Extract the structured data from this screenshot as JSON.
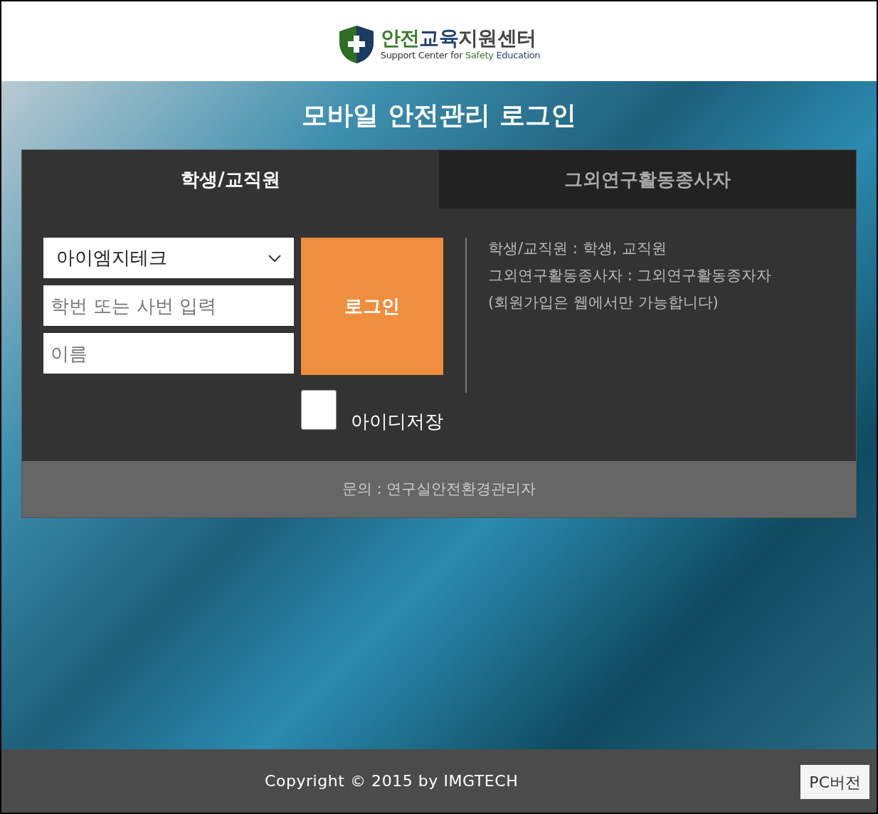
{
  "logo": {
    "title_parts": [
      {
        "text": "안전",
        "color": "#3a7d2c"
      },
      {
        "text": "교육",
        "color": "#1f3f6e"
      },
      {
        "text": "지원센터",
        "color": "#444444"
      }
    ],
    "subtitle_parts": [
      {
        "text": "Support Center for ",
        "color": "#333333"
      },
      {
        "text": "Safety",
        "color": "#3a7d2c"
      },
      {
        "text": " Education",
        "color": "#1f3f6e"
      }
    ]
  },
  "page_title": "모바일 안전관리 로그인",
  "tabs": [
    {
      "label": "학생/교직원",
      "selected": true
    },
    {
      "label": "그외연구활동종사자",
      "selected": false
    }
  ],
  "form": {
    "organization": "아이엠지테크",
    "id_placeholder": "학번 또는 사번 입력",
    "name_placeholder": "이름",
    "login_button": "로그인",
    "remember_id": {
      "label": "아이디저장",
      "checked": false
    }
  },
  "info_lines": [
    "학생/교직원 : 학생, 교직원",
    "그외연구활동종사자 : 그외연구활동종자자",
    "(회원가입은 웹에서만 가능합니다)"
  ],
  "contact": "문의 : 연구실안전환경관리자",
  "footer": {
    "copyright": "Copyright © 2015 by IMGTECH",
    "pc_version_button": "PC버전"
  }
}
